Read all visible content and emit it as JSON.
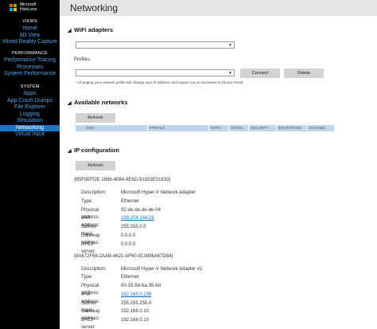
{
  "app": {
    "logo_line1": "Microsoft",
    "logo_line2": "HoloLens",
    "logo_colors": [
      "#f25022",
      "#7fba00",
      "#00a4ef",
      "#ffb900"
    ]
  },
  "sidebar": {
    "sections": [
      {
        "title": "VIEWS",
        "items": [
          "Home",
          "3D View",
          "Mixed Reality Capture"
        ]
      },
      {
        "title": "PERFORMANCE",
        "items": [
          "Performance Tracing",
          "Processes",
          "System Performance"
        ]
      },
      {
        "title": "SYSTEM",
        "items": [
          "Apps",
          "App Crash Dumps",
          "File Explorer",
          "Logging",
          "Simulation",
          "Networking",
          "Virtual Input"
        ]
      }
    ],
    "active_item": "Networking",
    "active_color": "#1a73c4",
    "link_color": "#4fa3e8"
  },
  "header": {
    "title": "Networking"
  },
  "wifi": {
    "title": "WiFi adapters",
    "adapter_value": "",
    "profiles_label": "Profiles",
    "profile_value": "",
    "connect_label": "Connect",
    "delete_label": "Delete",
    "note": "* Changing your network profile will change your IP address and require you to reconnect to Device Portal"
  },
  "networks": {
    "title": "Available networks",
    "refresh_label": "Refresh",
    "columns": [
      "SSID",
      "PROFILE",
      "INFRA",
      "SIGNAL",
      "SECURITY",
      "ENCRYPTION",
      "CHANNEL"
    ],
    "header_color": "#bcd7ee"
  },
  "ip": {
    "title": "IP configuration",
    "refresh_label": "Refresh",
    "labels": {
      "description": "Description:",
      "type": "Type:",
      "physical": "Physical address:",
      "ipv4": "IPv4 address:",
      "subnet": "Subnet mask:",
      "gateway": "Gateway address:",
      "dhcp": "DHCP server:"
    },
    "interfaces": [
      {
        "id": "{B5F9EFDE-1996-4084-9E6D-91833E31833}",
        "description": "Microsoft Hyper-V Network Adapter",
        "type": "Ethernet",
        "physical": "02-de-de-de-de-04",
        "ipv4": "169.254.144.29",
        "subnet": "255.255.0.0",
        "gateway": "0.0.0.0",
        "dhcp": "0.0.0.0"
      },
      {
        "id": "{8A672F58-2AAB-4621-AF60-913806A67D84}",
        "description": "Microsoft Hyper-V Network Adapter #2",
        "type": "Ethernet",
        "physical": "00-15-5d-6a-35-8d",
        "ipv4": "192.168.0.239",
        "subnet": "255.255.255.0",
        "gateway": "192.168.0.10",
        "dhcp": "192.168.0.10"
      }
    ]
  }
}
